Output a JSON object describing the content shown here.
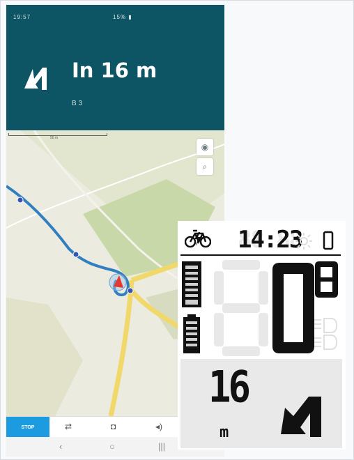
{
  "status_bar": {
    "left": "19:57",
    "right": "15% ▮"
  },
  "navigation": {
    "distance": "In 16 m",
    "street": "B 3"
  },
  "map": {
    "scale_label": "50 m"
  },
  "bottom_bar": {
    "stop_label": "STOP"
  },
  "display": {
    "time": "14:23",
    "speed": "0",
    "distance_value": "16",
    "distance_unit": "m"
  },
  "colors": {
    "header_teal": "#0d5564",
    "route_blue": "#2f7fc1",
    "stop_blue": "#1d9be1",
    "display_ink": "#111111"
  },
  "icons": [
    "turn-sharp-left-icon",
    "compass-icon",
    "zoom-icon",
    "route-icon",
    "camera-icon",
    "volume-icon",
    "back-icon",
    "home-icon",
    "recents-icon",
    "bike-assist-icon",
    "light-icon",
    "phone-icon",
    "battery-icon"
  ]
}
